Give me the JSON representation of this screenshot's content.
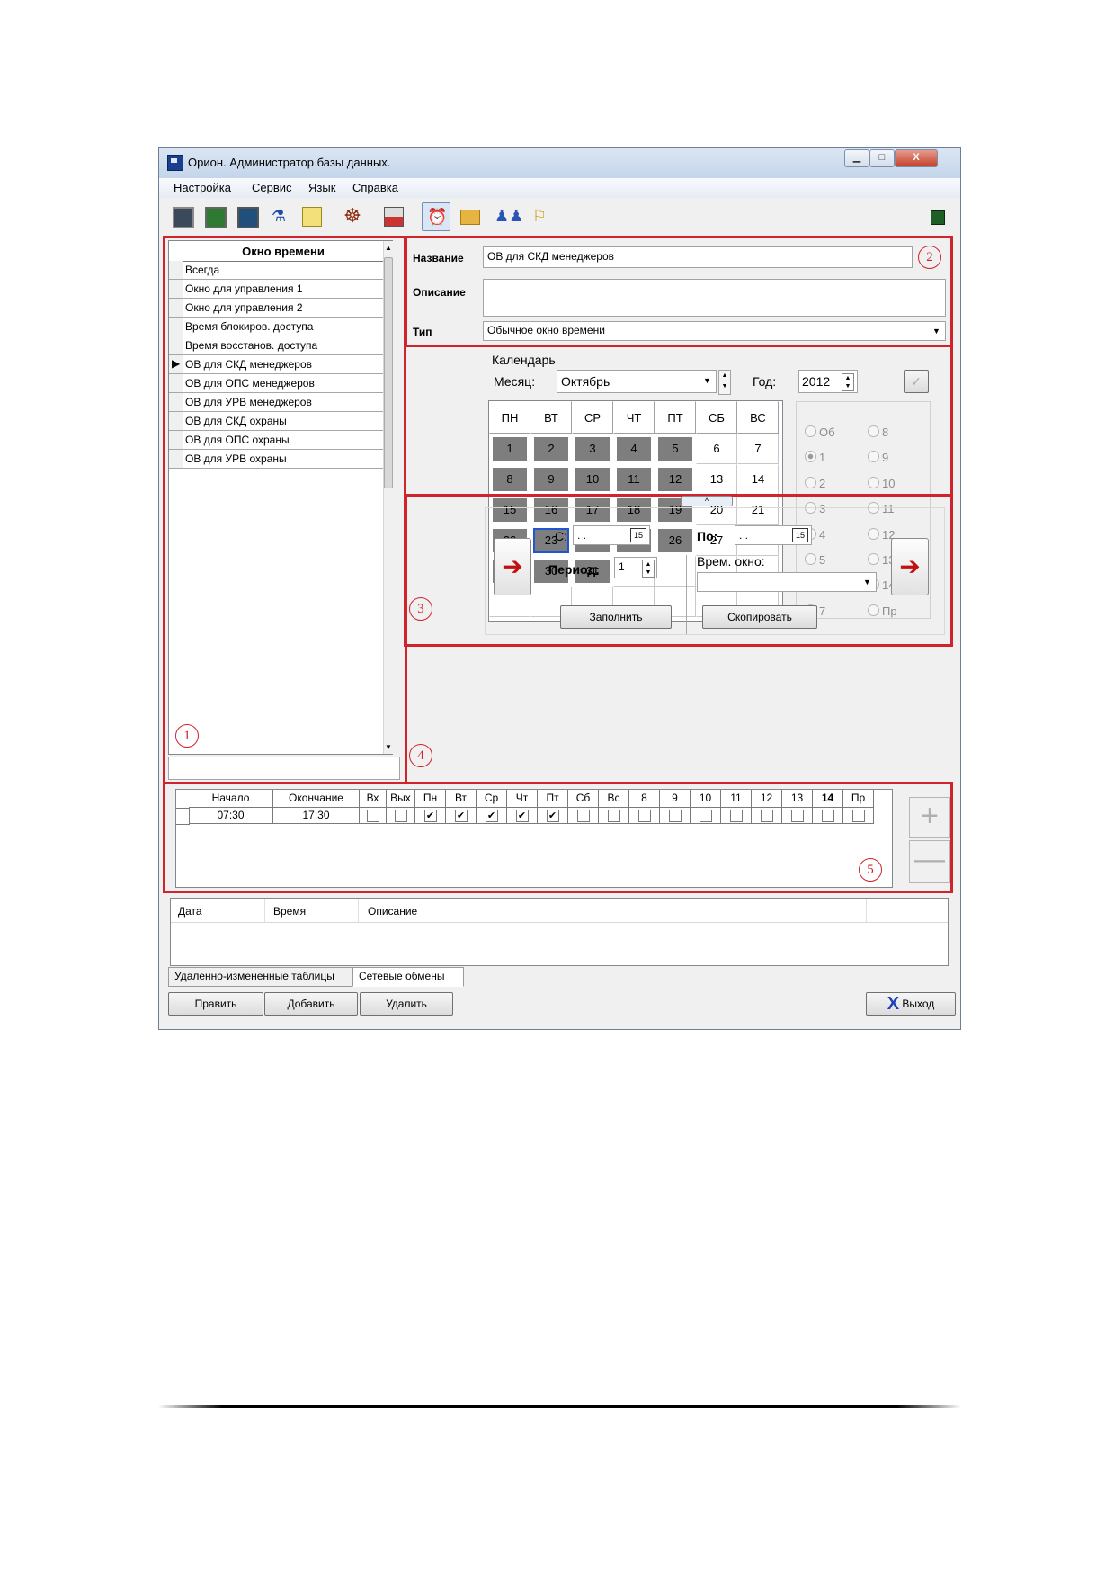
{
  "window": {
    "title": "Орион. Администратор базы данных.",
    "controls": {
      "minimize": "▁",
      "maximize": "□",
      "close": "X"
    }
  },
  "menu": [
    "Настройка",
    "Сервис",
    "Язык",
    "Справка"
  ],
  "toolbar_icons": [
    "reader-icon",
    "keypad-icon",
    "panel-icon",
    "person-icon",
    "document-icon",
    "helm-icon",
    "clock-printer-icon",
    "time-window-icon",
    "folder-icon",
    "users-icon",
    "key-user-icon"
  ],
  "markers": [
    "1",
    "2",
    "3",
    "4",
    "5"
  ],
  "list": {
    "header": "Окно времени",
    "items": [
      "Всегда",
      "Окно для управления 1",
      "Окно для управления 2",
      "Время блокиров. доступа",
      "Время восстанов. доступа",
      "ОВ для СКД менеджеров",
      "ОВ для ОПС менеджеров",
      "ОВ для УРВ менеджеров",
      "ОВ для СКД охраны",
      "ОВ для ОПС охраны",
      "ОВ для УРВ охраны"
    ],
    "selected_index": 5
  },
  "details": {
    "name_label": "Название",
    "name_value": "ОВ для СКД менеджеров",
    "desc_label": "Описание",
    "desc_value": "",
    "type_label": "Тип",
    "type_value": "Обычное окно времени"
  },
  "calendar": {
    "group_label": "Календарь",
    "month_label": "Месяц:",
    "month_value": "Октябрь",
    "year_label": "Год:",
    "year_value": "2012",
    "weekdays": [
      "ПН",
      "ВТ",
      "СР",
      "ЧТ",
      "ПТ",
      "СБ",
      "ВС"
    ],
    "days": [
      "1",
      "2",
      "3",
      "4",
      "5",
      "6",
      "7",
      "8",
      "9",
      "10",
      "11",
      "12",
      "13",
      "14",
      "15",
      "16",
      "17",
      "18",
      "19",
      "20",
      "21",
      "22",
      "23",
      "24",
      "25",
      "26",
      "27",
      "28",
      "29",
      "30",
      "31"
    ],
    "active_days": [
      1,
      2,
      3,
      4,
      5,
      8,
      9,
      10,
      11,
      12,
      15,
      16,
      17,
      18,
      19,
      22,
      23,
      24,
      25,
      26,
      29,
      30,
      31
    ],
    "selected_day": 23,
    "radio_left": [
      "Об",
      "1",
      "2",
      "3",
      "4",
      "5",
      "6",
      "7"
    ],
    "radio_right": [
      "8",
      "9",
      "10",
      "11",
      "12",
      "13",
      "14",
      "Пр"
    ],
    "radio_checked": "1"
  },
  "fill": {
    "from_label": "С:",
    "from_value": ". .",
    "to_label": "По:",
    "to_value": ". .",
    "period_label": "Период:",
    "period_value": "1",
    "window_label": "Врем. окно:",
    "window_value": "",
    "fill_button": "Заполнить",
    "copy_button": "Скопировать",
    "collapse_glyph": "^"
  },
  "intervals": {
    "columns": [
      "Начало",
      "Окончание",
      "Вх",
      "Вых",
      "Пн",
      "Вт",
      "Ср",
      "Чт",
      "Пт",
      "Сб",
      "Вс",
      "8",
      "9",
      "10",
      "11",
      "12",
      "13",
      "14",
      "Пр"
    ],
    "row": {
      "start": "07:30",
      "end": "17:30",
      "checks": [
        false,
        false,
        true,
        true,
        true,
        true,
        true,
        false,
        false,
        false,
        false,
        false,
        false,
        false,
        false,
        false,
        false
      ]
    },
    "add": "+",
    "remove": "—"
  },
  "log": {
    "columns": [
      "Дата",
      "Время",
      "Описание"
    ],
    "tabs": [
      "Удаленно-измененные таблицы",
      "Сетевые обмены"
    ],
    "active_tab": 1
  },
  "buttons": {
    "edit": "Править",
    "add": "Добавить",
    "delete": "Удалить",
    "exit": "Выход",
    "exit_icon": "X"
  }
}
